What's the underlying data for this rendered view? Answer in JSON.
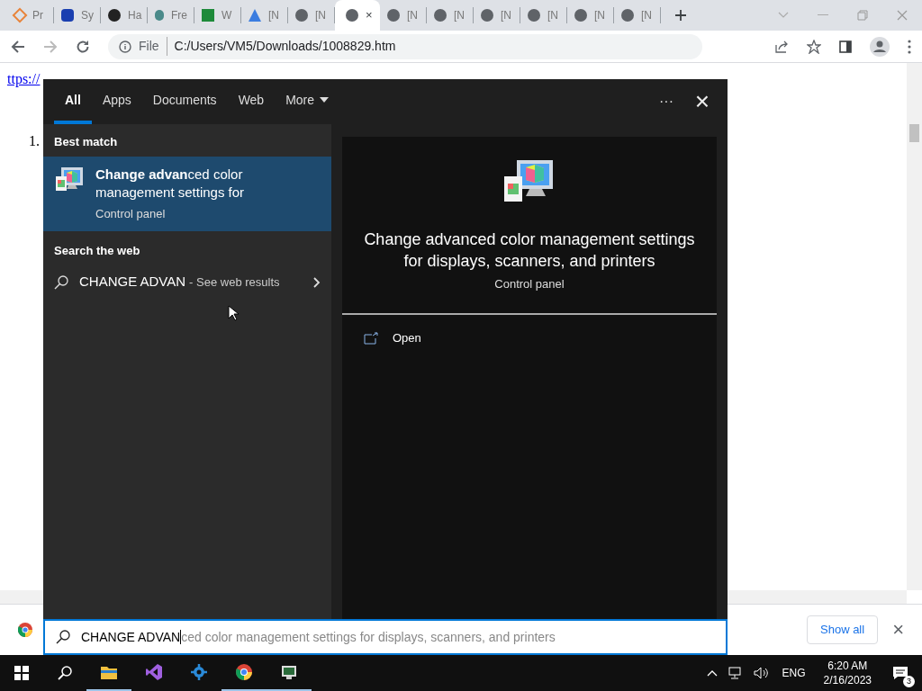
{
  "browser": {
    "tabs": [
      {
        "title": "Pr",
        "selected": false
      },
      {
        "title": "Sy",
        "selected": false
      },
      {
        "title": "Ha",
        "selected": false
      },
      {
        "title": "Fre",
        "selected": false
      },
      {
        "title": "W",
        "selected": false
      },
      {
        "title": "[N",
        "selected": false
      },
      {
        "title": "[N",
        "selected": false
      },
      {
        "title": "×",
        "selected": true
      },
      {
        "title": "[N",
        "selected": false
      },
      {
        "title": "[N",
        "selected": false
      },
      {
        "title": "[N",
        "selected": false
      },
      {
        "title": "[N",
        "selected": false
      },
      {
        "title": "[N",
        "selected": false
      },
      {
        "title": "[N",
        "selected": false
      }
    ],
    "address": {
      "scheme": "File",
      "url": "C:/Users/VM5/Downloads/1008829.htm"
    },
    "page": {
      "link": "ttps://",
      "list_number": "1."
    },
    "download_bar": {
      "show_all": "Show all",
      "close": "×"
    }
  },
  "search": {
    "tabs": [
      {
        "label": "All",
        "selected": true
      },
      {
        "label": "Apps",
        "selected": false
      },
      {
        "label": "Documents",
        "selected": false
      },
      {
        "label": "Web",
        "selected": false
      },
      {
        "label": "More",
        "selected": false
      }
    ],
    "more_menu": "···",
    "close": "×",
    "best_match": {
      "heading": "Best match",
      "title": "**Change advan**ced color management settings for",
      "subtitle": "Control panel",
      "selected": true
    },
    "web": {
      "heading": "Search the web",
      "query": "CHANGE ADVAN",
      "suffix": "- See web results"
    },
    "preview": {
      "title": "Change advanced color management settings for displays, scanners, and printers",
      "subtitle": "Control panel",
      "actions": [
        "Open"
      ]
    },
    "box": {
      "value": "CHANGE ADVAN",
      "suggestion": "ced color management settings for displays, scanners, and printers"
    }
  },
  "taskbar": {
    "apps": [
      {
        "kind": "folder",
        "selected": true
      },
      {
        "kind": "studio",
        "selected": false
      },
      {
        "kind": "tool",
        "selected": false
      },
      {
        "kind": "chrome",
        "selected": true
      },
      {
        "kind": "terminal",
        "selected": true
      }
    ],
    "language": "ENG",
    "time": "6:20 AM",
    "date": "2/16/2023",
    "notifications": "3"
  }
}
